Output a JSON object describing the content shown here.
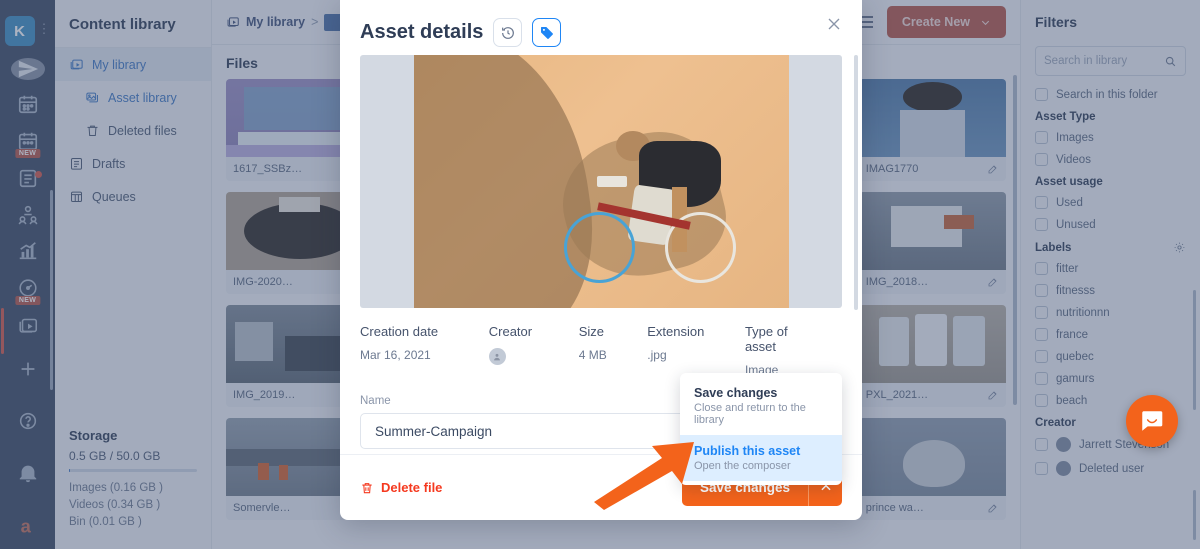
{
  "rail": {
    "logo_letter": "K",
    "items": [
      {
        "name": "send-icon",
        "badge": ""
      },
      {
        "name": "calendar-icon",
        "badge": ""
      },
      {
        "name": "calendar-new-icon",
        "badge": "NEW"
      },
      {
        "name": "content-plan-icon",
        "badge": ""
      },
      {
        "name": "audience-icon",
        "badge": ""
      },
      {
        "name": "analytics-icon",
        "badge": ""
      },
      {
        "name": "dashboard-icon",
        "badge": "NEW"
      },
      {
        "name": "media-library-icon",
        "badge": ""
      }
    ],
    "bottom_items": [
      {
        "name": "add-icon"
      },
      {
        "name": "help-icon"
      },
      {
        "name": "notifications-icon"
      },
      {
        "name": "account-avatar"
      }
    ]
  },
  "library": {
    "title": "Content library",
    "items": [
      {
        "label": "My library",
        "icon": "media-library-icon",
        "selected": true,
        "sub": false
      },
      {
        "label": "Asset library",
        "icon": "images-icon",
        "selected": false,
        "sub": true,
        "blue": true
      },
      {
        "label": "Deleted files",
        "icon": "trash-icon",
        "selected": false,
        "sub": true,
        "blue": false
      },
      {
        "label": "Drafts",
        "icon": "drafts-icon",
        "selected": false,
        "sub": false
      },
      {
        "label": "Queues",
        "icon": "queues-icon",
        "selected": false,
        "sub": false
      }
    ],
    "storage": {
      "title": "Storage",
      "amount": "0.5 GB / 50.0 GB",
      "lines": [
        "Images (0.16 GB )",
        "Videos (0.34 GB )",
        "Bin (0.01 GB )"
      ]
    }
  },
  "topbar": {
    "breadcrumb_root": "My library",
    "breadcrumb_sep": ">",
    "create_button": "Create New"
  },
  "files": {
    "heading": "Files",
    "items": [
      {
        "name": "1617_SSBz…",
        "thumb": "stay-at-home"
      },
      {
        "name": "",
        "thumb": "hidden"
      },
      {
        "name": "",
        "thumb": "hidden"
      },
      {
        "name": "",
        "thumb": "hidden"
      },
      {
        "name": "IMAG1770",
        "thumb": "portrait"
      },
      {
        "name": "IMG-2020…",
        "thumb": "camembert"
      },
      {
        "name": "",
        "thumb": "hidden"
      },
      {
        "name": "",
        "thumb": "hidden"
      },
      {
        "name": "",
        "thumb": "street"
      },
      {
        "name": "IMG_2018…",
        "thumb": "market"
      },
      {
        "name": "IMG_2019…",
        "thumb": "bikes"
      },
      {
        "name": "",
        "thumb": "hidden"
      },
      {
        "name": "",
        "thumb": "hidden"
      },
      {
        "name": "",
        "thumb": "shelf"
      },
      {
        "name": "PXL_2021…",
        "thumb": "cans"
      },
      {
        "name": "Somervle…",
        "thumb": "cars"
      },
      {
        "name": "",
        "thumb": "hidden"
      },
      {
        "name": "",
        "thumb": "hidden"
      },
      {
        "name": "",
        "thumb": "water"
      },
      {
        "name": "prince wa…",
        "thumb": "portrait2"
      }
    ]
  },
  "filters": {
    "title": "Filters",
    "search_placeholder": "Search in library",
    "search_value": "",
    "search_in_folder": "Search in this folder",
    "groups": [
      {
        "title": "Asset Type",
        "options": [
          "Images",
          "Videos"
        ]
      },
      {
        "title": "Asset usage",
        "options": [
          "Used",
          "Unused"
        ]
      },
      {
        "title": "Labels",
        "gear": true,
        "options": [
          "fitter",
          "fitnesss",
          "nutritionnn",
          "france",
          "quebec",
          "gamurs",
          "beach"
        ]
      },
      {
        "title": "Creator",
        "avatars": true,
        "options": [
          "Jarrett Stevenson",
          "Deleted user"
        ]
      }
    ]
  },
  "modal": {
    "title": "Asset details",
    "history_icon": "history-icon",
    "tag_icon": "tag-icon",
    "close_icon": "close-icon",
    "meta": [
      {
        "header": "Creation date",
        "value": "Mar 16, 2021"
      },
      {
        "header": "Creator",
        "value": ""
      },
      {
        "header": "Size",
        "value": "4 MB"
      },
      {
        "header": "Extension",
        "value": ".jpg"
      },
      {
        "header": "Type of asset",
        "value": "Image"
      }
    ],
    "name_label": "Name",
    "name_value": "Summer-Campaign",
    "delete_label": "Delete file",
    "save_label": "Save changes",
    "dropdown": [
      {
        "title": "Save changes",
        "subtitle": "Close and return to the library",
        "highlighted": false
      },
      {
        "title": "Publish this asset",
        "subtitle": "Open the composer",
        "highlighted": true
      }
    ]
  },
  "colors": {
    "accent_orange": "#f3631b",
    "danger_red": "#f5391f",
    "link_blue": "#1f86f5",
    "rail_bg": "#3b4a63"
  }
}
